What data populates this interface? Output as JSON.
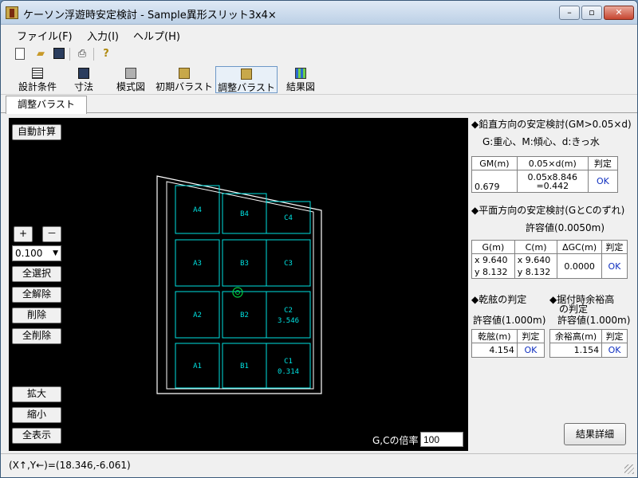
{
  "window": {
    "title": "ケーソン浮遊時安定検討 - Sample異形スリット3x4×",
    "min": "–",
    "max": "▫",
    "close": "✕"
  },
  "menu": [
    "ファイル(F)",
    "入力(I)",
    "ヘルプ(H)"
  ],
  "toolbar_icons": [
    "new-file",
    "open-folder",
    "save",
    "print",
    "help"
  ],
  "modes": [
    {
      "label": "設計条件",
      "icon": "table-icon"
    },
    {
      "label": "寸法",
      "icon": "floppy-icon"
    },
    {
      "label": "模式図",
      "icon": "model-icon"
    },
    {
      "label": "初期バラスト",
      "icon": "ballast-icon"
    },
    {
      "label": "調整バラスト",
      "icon": "ballast-adjust-icon",
      "active": true
    },
    {
      "label": "結果図",
      "icon": "result-icon"
    }
  ],
  "tab": "調整バラスト",
  "canvas": {
    "auto_calc": "自動計算",
    "plus": "+",
    "minus": "－",
    "step_value": "0.100",
    "select_all": "全選択",
    "deselect_all": "全解除",
    "delete": "削除",
    "delete_all": "全削除",
    "zoom_in": "拡大",
    "zoom_out": "縮小",
    "show_all": "全表示",
    "gc_ratio_label": "G,Cの倍率",
    "gc_ratio_value": "100",
    "cells": [
      {
        "id": "A4",
        "value": ""
      },
      {
        "id": "B4",
        "value": ""
      },
      {
        "id": "C4",
        "value": ""
      },
      {
        "id": "A3",
        "value": ""
      },
      {
        "id": "B3",
        "value": ""
      },
      {
        "id": "C3",
        "value": ""
      },
      {
        "id": "A2",
        "value": ""
      },
      {
        "id": "B2",
        "value": ""
      },
      {
        "id": "C2",
        "value": "3.546"
      },
      {
        "id": "A1",
        "value": ""
      },
      {
        "id": "B1",
        "value": ""
      },
      {
        "id": "C1",
        "value": "0.314"
      }
    ],
    "colors": {
      "outline": "#ffffff",
      "cells": "#00e0e0",
      "marker": "#00d040",
      "background": "#000000"
    }
  },
  "vertical": {
    "heading": "◆鉛直方向の安定検討(GM>0.05×d)",
    "note": "G:重心、M:傾心、d:きっ水",
    "headers": [
      "GM(m)",
      "0.05×d(m)",
      "判定"
    ],
    "gm": "0.679",
    "calc_line1": "0.05x8.846",
    "calc_line2": "=0.442",
    "judge": "OK"
  },
  "planar": {
    "heading": "◆平面方向の安定検討(GとCのずれ)",
    "allow": "許容値(0.0050m)",
    "headers": [
      "G(m)",
      "C(m)",
      "ΔGC(m)",
      "判定"
    ],
    "gx": "x   9.640",
    "gy": "y   8.132",
    "cx": "x   9.640",
    "cy": "y   8.132",
    "dgc": "0.0000",
    "judge": "OK"
  },
  "freeboard": {
    "heading": "◆乾舷の判定",
    "allow": "許容値(1.000m)",
    "headers": [
      "乾舷(m)",
      "判定"
    ],
    "value": "4.154",
    "judge": "OK"
  },
  "margin": {
    "heading_line1": "◆据付時余裕高",
    "heading_line2": "の判定",
    "allow": "許容値(1.000m)",
    "headers": [
      "余裕高(m)",
      "判定"
    ],
    "value": "1.154",
    "judge": "OK"
  },
  "detail_button": "結果詳細",
  "status": "(X↑,Y←)=(18.346,-6.061)"
}
